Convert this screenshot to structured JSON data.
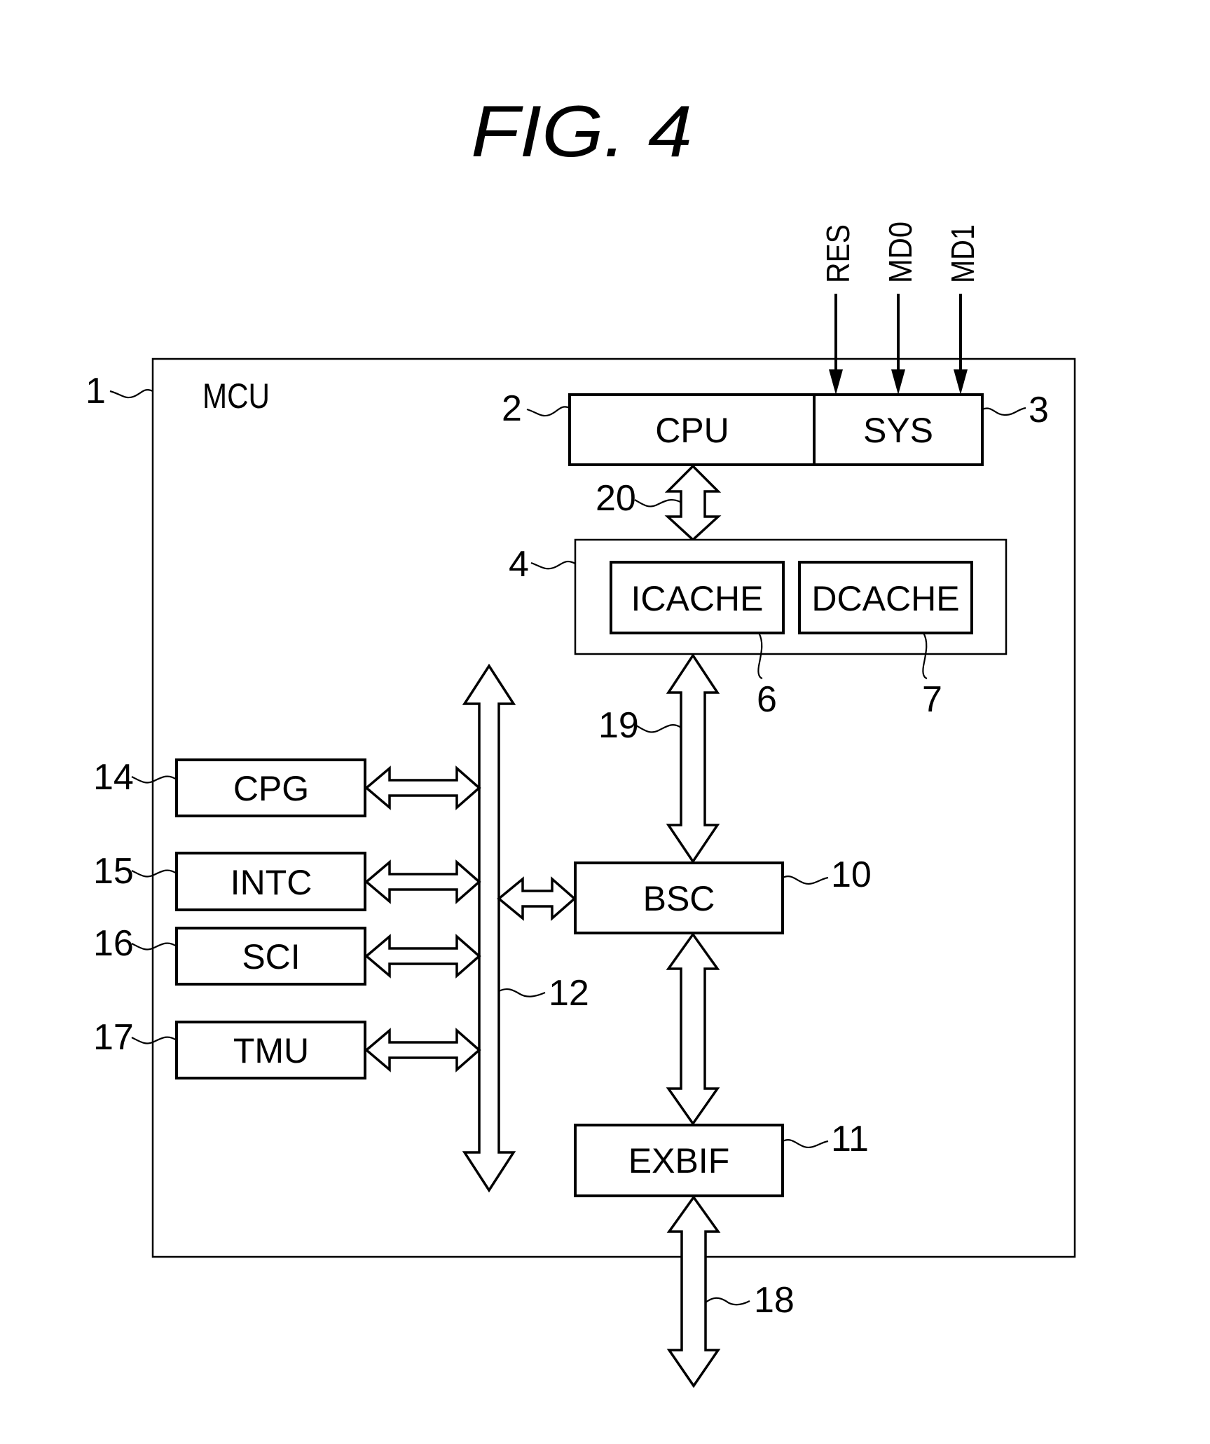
{
  "figure": {
    "title": "FIG.  4"
  },
  "mcu": {
    "label": "MCU",
    "ref": "1"
  },
  "blocks": {
    "cpu": {
      "label": "CPU",
      "ref": "2"
    },
    "sys": {
      "label": "SYS",
      "ref": "3"
    },
    "cache": {
      "ref": "4"
    },
    "icache": {
      "label": "ICACHE",
      "ref": "6"
    },
    "dcache": {
      "label": "DCACHE",
      "ref": "7"
    },
    "bsc": {
      "label": "BSC",
      "ref": "10"
    },
    "exbif": {
      "label": "EXBIF",
      "ref": "11"
    },
    "cpg": {
      "label": "CPG",
      "ref": "14"
    },
    "intc": {
      "label": "INTC",
      "ref": "15"
    },
    "sci": {
      "label": "SCI",
      "ref": "16"
    },
    "tmu": {
      "label": "TMU",
      "ref": "17"
    }
  },
  "buses": {
    "peripheral_bus": {
      "ref": "12"
    },
    "external_bus": {
      "ref": "18"
    },
    "cache_bsc_bus": {
      "ref": "19"
    },
    "cpu_cache_bus": {
      "ref": "20"
    }
  },
  "signals": [
    {
      "name": "RES"
    },
    {
      "name": "MD0"
    },
    {
      "name": "MD1"
    }
  ]
}
